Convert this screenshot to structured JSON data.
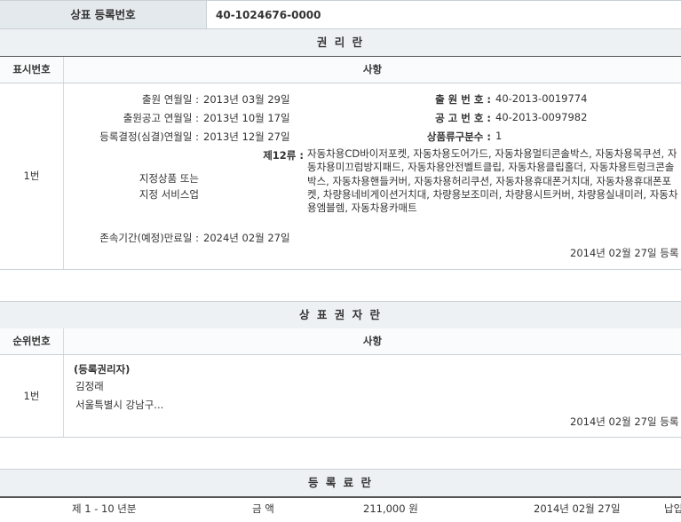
{
  "top": {
    "label": "상표 등록번호",
    "value": "40-1024676-0000"
  },
  "rights": {
    "title": "권 리 란",
    "header": {
      "col1": "표시번호",
      "col2": "사항"
    },
    "row_no": "1번",
    "app_date_label": "출원 연월일 :",
    "app_date": "2013년 03월 29일",
    "app_no_label": "출 원 번 호 :",
    "app_no": "40-2013-0019774",
    "pub_date_label": "출원공고 연월일 :",
    "pub_date": "2013년 10월 17일",
    "pub_no_label": "공 고 번 호 :",
    "pub_no": "40-2013-0097982",
    "decision_label": "등록결정(심결)연월일 :",
    "decision_date": "2013년 12월 27일",
    "class_count_label": "상품류구분수 :",
    "class_count": "1",
    "designated_label_1": "지정상품 또는",
    "designated_label_2": "지정 서비스업",
    "class_label": "제12류 :",
    "goods": "자동차용CD바이저포켓, 자동차용도어가드, 자동차용멀티콘솔박스, 자동차용목쿠션, 자동차용미끄럼방지패드, 자동차용안전벨트클립, 자동차용클립홀더, 자동차용트렁크콘솔박스, 자동차용핸들커버, 자동차용허리쿠션, 자동차용휴대폰거치대, 자동차용휴대폰포켓, 차량용네비게이션거치대, 차량용보조미러, 차량용시트커버, 차량용실내미러, 자동차용엠블렘, 자동차용카매트",
    "expiry_label": "존속기간(예정)만료일 :",
    "expiry_date": "2024년 02월 27일",
    "reg_line": "2014년 02월 27일 등록"
  },
  "holder": {
    "title": "상 표 권 자 란",
    "header": {
      "col1": "순위번호",
      "col2": "사항"
    },
    "row_no": "1번",
    "type": "(등록권리자)",
    "name": "김정래",
    "address": "서울특별시 강남구...",
    "reg_line": "2014년 02월 27일 등록"
  },
  "fee": {
    "title": "등 록 료 란",
    "period": "제 1 - 10 년분",
    "amount_label": "금 액",
    "amount": "211,000 원",
    "date": "2014년 02월 27일",
    "status": "납입"
  }
}
